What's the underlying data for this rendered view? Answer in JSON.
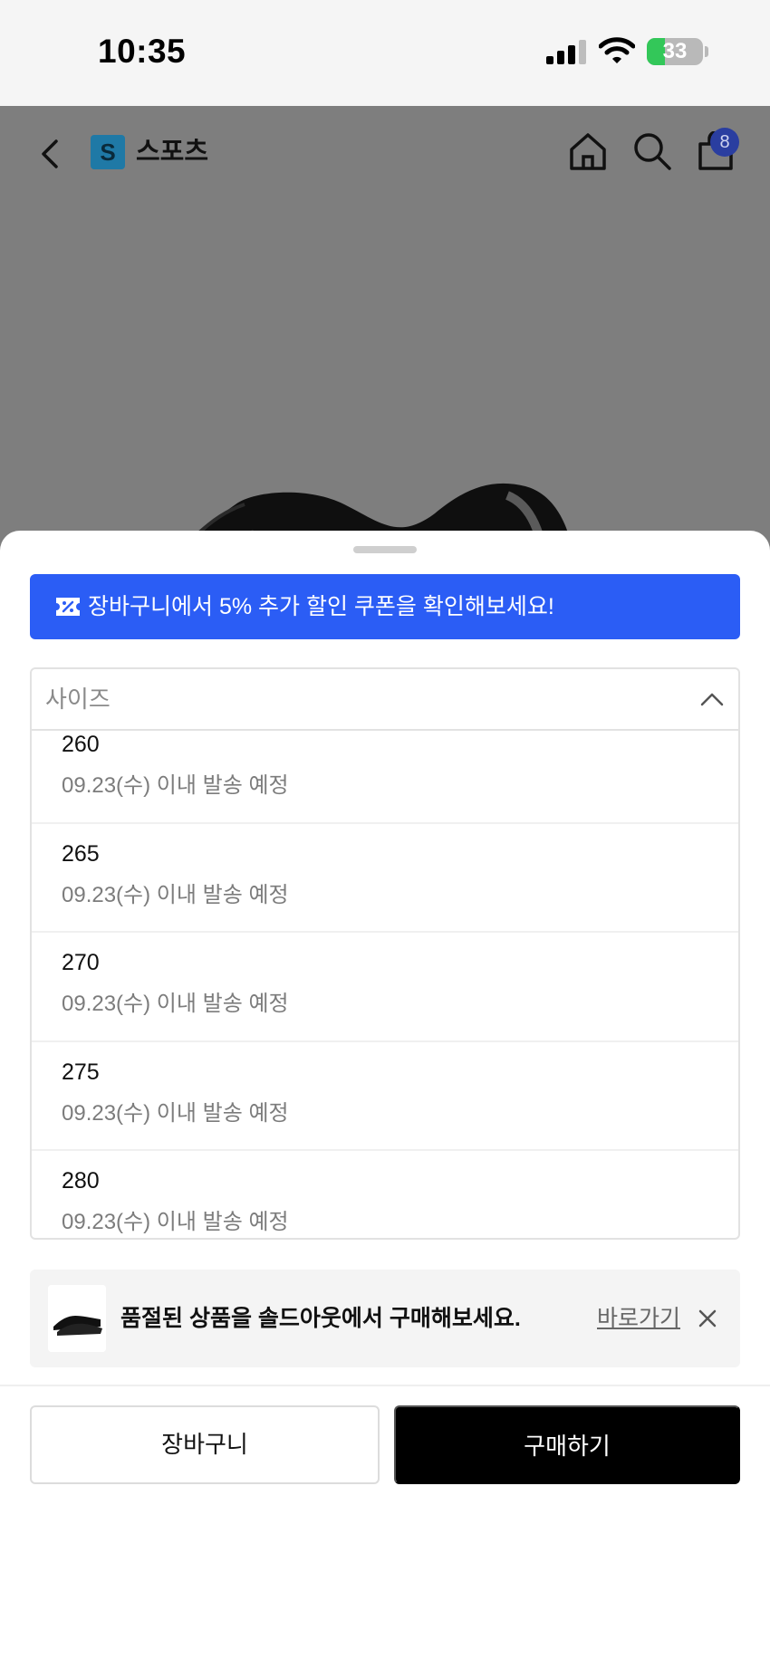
{
  "status_bar": {
    "time": "10:35",
    "battery_level": "33",
    "battery_percent": 33,
    "battery_color": "#33c759",
    "icons": [
      "cellular-signal-icon",
      "wifi-icon",
      "battery-charging-icon"
    ]
  },
  "header": {
    "back_icon": "chevron-left-icon",
    "brand_logo": "S",
    "brand_name": "스포츠",
    "icons": [
      "home-icon",
      "search-icon",
      "shopping-bag-icon"
    ],
    "cart_badge": "8"
  },
  "coupon_banner": {
    "icon": "coupon-ticket-icon",
    "text": "장바구니에서 5% 추가 할인 쿠폰을 확인해보세요!",
    "color": "#2b5df5"
  },
  "size_select": {
    "label": "사이즈",
    "chevron_icon": "chevron-up-icon",
    "options": [
      {
        "size": "260",
        "shipping": "09.23(수) 이내 발송 예정"
      },
      {
        "size": "265",
        "shipping": "09.23(수) 이내 발송 예정"
      },
      {
        "size": "270",
        "shipping": "09.23(수) 이내 발송 예정"
      },
      {
        "size": "275",
        "shipping": "09.23(수) 이내 발송 예정"
      },
      {
        "size": "280",
        "shipping": "09.23(수) 이내 발송 예정"
      }
    ]
  },
  "soldout_banner": {
    "text": "품절된 상품을 솔드아웃에서 구매해보세요.",
    "link": "바로가기",
    "close_icon": "close-icon"
  },
  "actions": {
    "cart_label": "장바구니",
    "buy_label": "구매하기"
  }
}
